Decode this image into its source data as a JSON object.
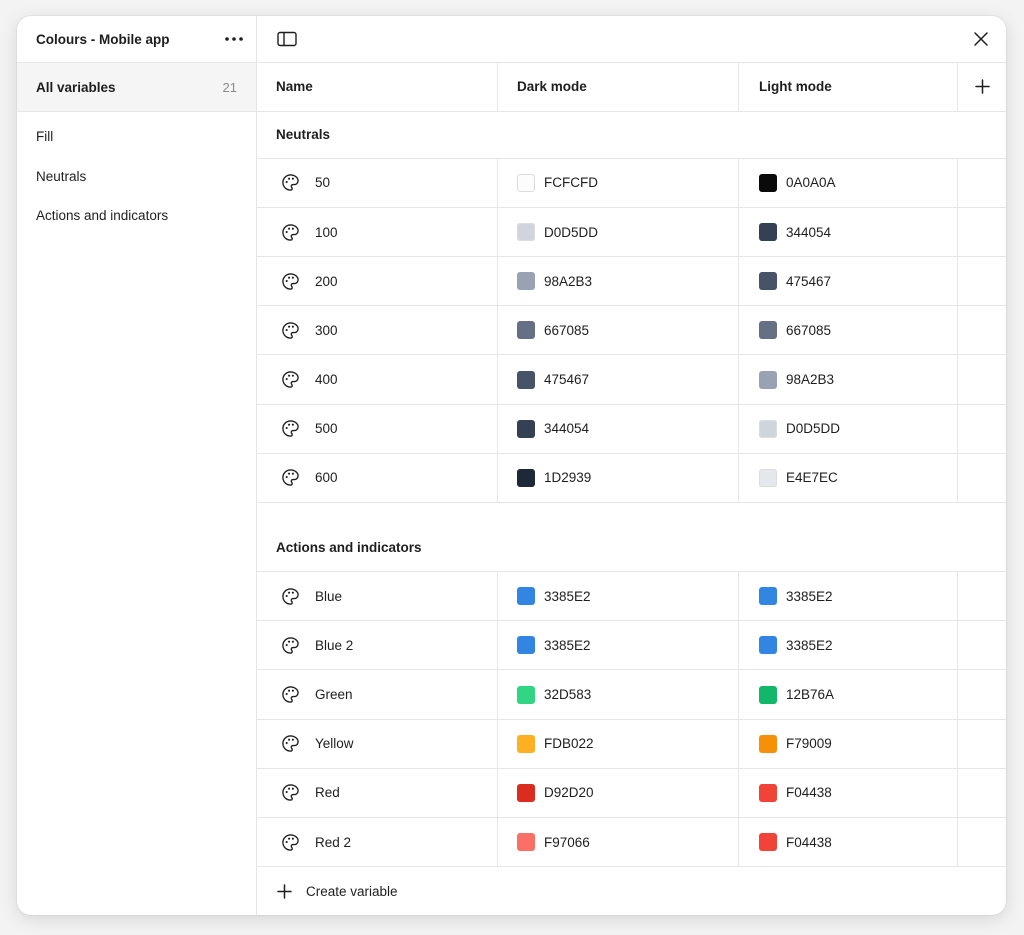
{
  "sidebar": {
    "title": "Colours - Mobile app",
    "all_variables": {
      "label": "All variables",
      "count": "21"
    },
    "groups": [
      "Fill",
      "Neutrals",
      "Actions and indicators"
    ]
  },
  "table": {
    "columns": {
      "name": "Name",
      "dark": "Dark mode",
      "light": "Light mode"
    },
    "sections": [
      {
        "title": "Neutrals",
        "rows": [
          {
            "name": "50",
            "dark": "FCFCFD",
            "light": "0A0A0A",
            "dark_color": "#FCFCFD",
            "light_color": "#0A0A0A"
          },
          {
            "name": "100",
            "dark": "D0D5DD",
            "light": "344054",
            "dark_color": "#D0D5DD",
            "light_color": "#344054"
          },
          {
            "name": "200",
            "dark": "98A2B3",
            "light": "475467",
            "dark_color": "#98A2B3",
            "light_color": "#475467"
          },
          {
            "name": "300",
            "dark": "667085",
            "light": "667085",
            "dark_color": "#667085",
            "light_color": "#667085"
          },
          {
            "name": "400",
            "dark": "475467",
            "light": "98A2B3",
            "dark_color": "#475467",
            "light_color": "#98A2B3"
          },
          {
            "name": "500",
            "dark": "344054",
            "light": "D0D5DD",
            "dark_color": "#344054",
            "light_color": "#D0D5DD"
          },
          {
            "name": "600",
            "dark": "1D2939",
            "light": "E4E7EC",
            "dark_color": "#1D2939",
            "light_color": "#E4E7EC"
          }
        ]
      },
      {
        "title": "Actions and indicators",
        "rows": [
          {
            "name": "Blue",
            "dark": "3385E2",
            "light": "3385E2",
            "dark_color": "#3385E2",
            "light_color": "#3385E2"
          },
          {
            "name": "Blue 2",
            "dark": "3385E2",
            "light": "3385E2",
            "dark_color": "#3385E2",
            "light_color": "#3385E2"
          },
          {
            "name": "Green",
            "dark": "32D583",
            "light": "12B76A",
            "dark_color": "#32D583",
            "light_color": "#12B76A"
          },
          {
            "name": "Yellow",
            "dark": "FDB022",
            "light": "F79009",
            "dark_color": "#FDB022",
            "light_color": "#F79009"
          },
          {
            "name": "Red",
            "dark": "D92D20",
            "light": "F04438",
            "dark_color": "#D92D20",
            "light_color": "#F04438"
          },
          {
            "name": "Red 2",
            "dark": "F97066",
            "light": "F04438",
            "dark_color": "#F97066",
            "light_color": "#F04438"
          }
        ]
      }
    ],
    "create_label": "Create variable"
  },
  "icons": {
    "more": "more-horizontal-icon",
    "sidebar_toggle": "sidebar-toggle-icon",
    "close": "close-icon",
    "add": "plus-icon",
    "variable": "palette-icon"
  }
}
